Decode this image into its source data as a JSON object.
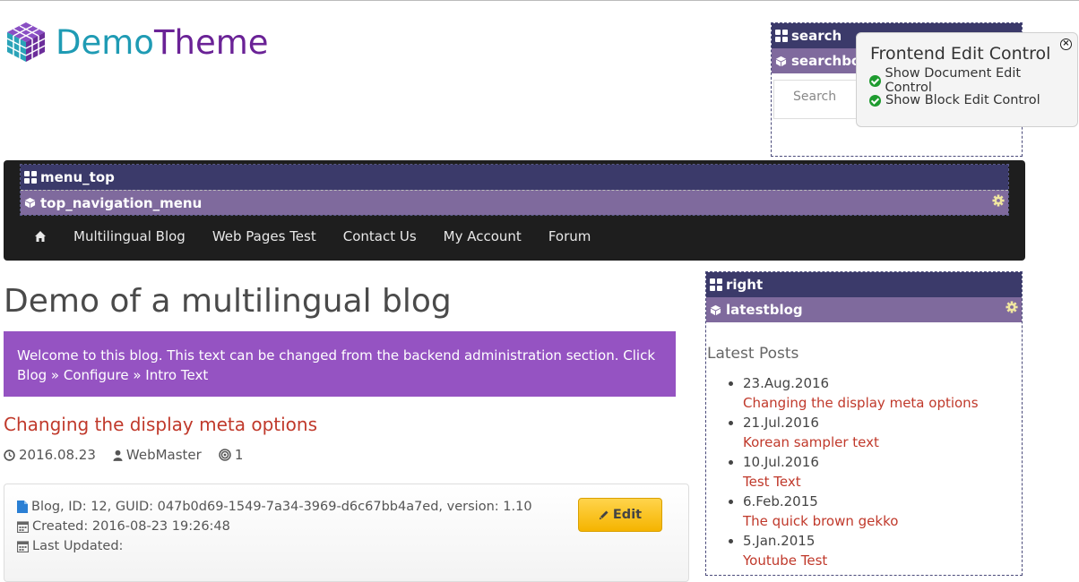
{
  "logo": {
    "part1": "Demo",
    "part2": "Theme"
  },
  "search": {
    "container_label": "search",
    "block_label": "searchbox",
    "placeholder": "Search"
  },
  "frontend_edit": {
    "title": "Frontend Edit Control",
    "options": [
      "Show Document Edit Control",
      "Show Block Edit Control"
    ]
  },
  "menu_top": {
    "container_label": "menu_top",
    "block_label": "top_navigation_menu",
    "links": [
      "Multilingual Blog",
      "Web Pages Test",
      "Contact Us",
      "My Account",
      "Forum"
    ]
  },
  "main": {
    "page_title": "Demo of a multilingual blog",
    "intro": "Welcome to this blog. This text can be changed from the backend administration section. Click Blog » Configure » Intro Text",
    "post": {
      "title": "Changing the display meta options",
      "date": "2016.08.23",
      "author": "WebMaster",
      "comments": "1"
    },
    "info": {
      "line1": "Blog, ID: 12, GUID: 047b0d69-1549-7a34-3969-d6c67bb4a7ed, version: 1.10",
      "line2": "Created: 2016-08-23 19:26:48",
      "line3": "Last Updated:",
      "edit_label": "Edit"
    }
  },
  "right": {
    "container_label": "right",
    "block_label": "latestblog",
    "heading": "Latest Posts",
    "posts": [
      {
        "date": "23.Aug.2016",
        "title": "Changing the display meta options"
      },
      {
        "date": "21.Jul.2016",
        "title": "Korean sampler text"
      },
      {
        "date": "10.Jul.2016",
        "title": "Test Text"
      },
      {
        "date": "6.Feb.2015",
        "title": "The quick brown gekko"
      },
      {
        "date": "5.Jan.2015",
        "title": "Youtube Test"
      }
    ]
  },
  "colors": {
    "container_header": "#3b3a6a",
    "block_header": "#7f6a9d",
    "intro_bg": "#9553c2",
    "link_red": "#c0392b",
    "navbar_bg": "#1e1e1e"
  }
}
